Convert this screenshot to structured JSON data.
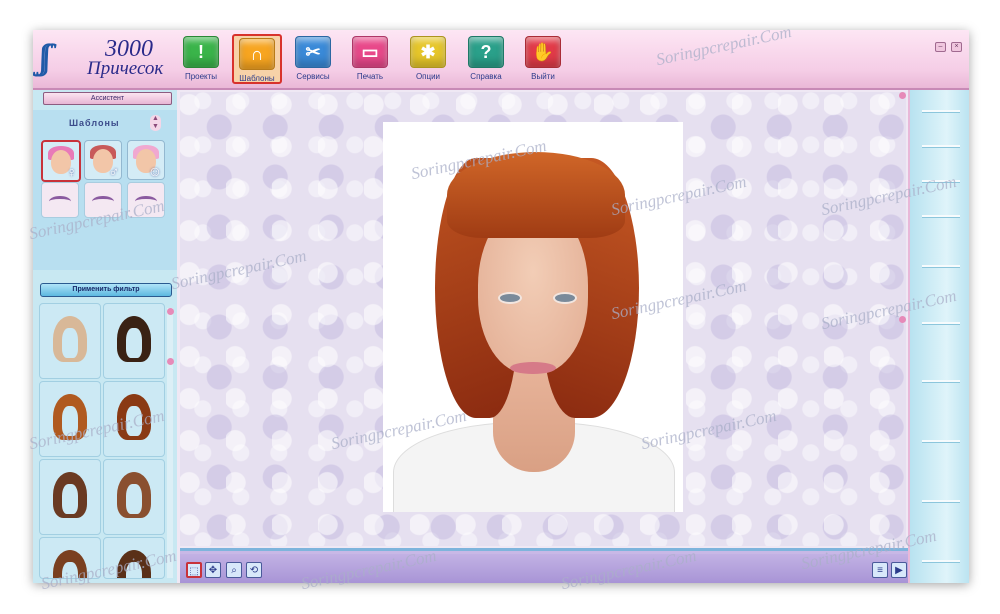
{
  "app": {
    "logo_number": "3000",
    "logo_word": "Причесок"
  },
  "toolbar": {
    "buttons": [
      {
        "label": "Проекты",
        "icon": "folder-exclamation-icon",
        "color": "#3ab44a"
      },
      {
        "label": "Шаблоны",
        "icon": "hair-template-icon",
        "color": "#f7a520",
        "active": true
      },
      {
        "label": "Сервисы",
        "icon": "scissors-icon",
        "color": "#3a8ad8"
      },
      {
        "label": "Печать",
        "icon": "printer-icon",
        "color": "#e8488a"
      },
      {
        "label": "Опции",
        "icon": "options-gear-icon",
        "color": "#e6c62a"
      },
      {
        "label": "Справка",
        "icon": "help-question-icon",
        "color": "#2aa08a"
      },
      {
        "label": "Выйти",
        "icon": "exit-hand-icon",
        "color": "#e23a48"
      }
    ],
    "icon_glyphs": [
      "!",
      "∩",
      "✂",
      "▭",
      "✱",
      "?",
      "✋"
    ]
  },
  "left_panel": {
    "assistant_label": "Ассистент",
    "templates_title": "Шаблоны",
    "categories": [
      {
        "name": "female-templates",
        "symbol": "♀",
        "hair": "#e87ab8",
        "selected": true
      },
      {
        "name": "male-templates",
        "symbol": "♂",
        "hair": "#c85a5a"
      },
      {
        "name": "child-templates",
        "symbol": "☺",
        "hair": "#f0a8d0"
      }
    ],
    "eye_categories": [
      "eyes-1",
      "eyes-2",
      "eyes-3"
    ],
    "apply_filter_label": "Применить фильтр",
    "hairstyles": [
      {
        "color": "#d8b898"
      },
      {
        "color": "#3a2214"
      },
      {
        "color": "#b05a20"
      },
      {
        "color": "#8a3a14"
      },
      {
        "color": "#6a3a22"
      },
      {
        "color": "#8a5030"
      },
      {
        "color": "#7a4020"
      },
      {
        "color": "#5a3018"
      }
    ]
  },
  "bottom_bar": {
    "tools": [
      {
        "icon": "select-move-icon",
        "glyph": "⬚",
        "selected": true
      },
      {
        "icon": "move-arrows-icon",
        "glyph": "✥"
      },
      {
        "icon": "zoom-icon",
        "glyph": "⌕"
      },
      {
        "icon": "rotate-icon",
        "glyph": "⟲"
      }
    ],
    "right_tools": [
      {
        "icon": "list-icon",
        "glyph": "≡"
      },
      {
        "icon": "slideshow-icon",
        "glyph": "▶"
      }
    ]
  },
  "watermark": "Soringpcrepair.Com",
  "colors": {
    "toolbar_bg": "#f5cde6",
    "panel_bg": "#c8e8f2",
    "canvas_bg": "#e6e0f0",
    "accent_red": "#c8323a"
  }
}
